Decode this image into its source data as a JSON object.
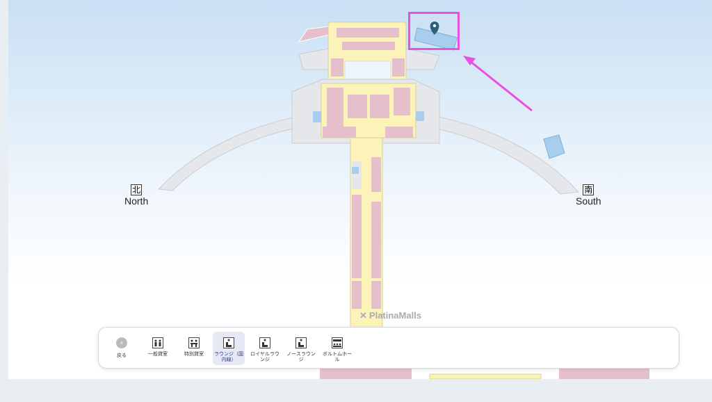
{
  "compass": {
    "north_kanji": "北",
    "north_label": "North",
    "south_kanji": "南",
    "south_label": "South"
  },
  "watermark": "PlatinaMalls",
  "toolbar": {
    "back_label": "戻る",
    "categories": [
      {
        "label": "一般貸室",
        "icon": "people-icon",
        "active": false
      },
      {
        "label": "特別貸室",
        "icon": "meeting-icon",
        "active": false
      },
      {
        "label": "ラウンジ（国内線）",
        "icon": "lounge-seat-icon",
        "active": true
      },
      {
        "label": "ロイヤルラウンジ",
        "icon": "royal-lounge-icon",
        "active": false
      },
      {
        "label": "ノースラウンジ",
        "icon": "north-lounge-icon",
        "active": false
      },
      {
        "label": "ボルトムホール",
        "icon": "hall-icon",
        "active": false
      }
    ]
  },
  "colors": {
    "shop_pink": "#e6bfcd",
    "corridor_yellow": "#fbf3b8",
    "lounge_blue": "#a8cdee",
    "annotation_magenta": "#e94fe0",
    "marker_teal": "#2c5f7a"
  }
}
